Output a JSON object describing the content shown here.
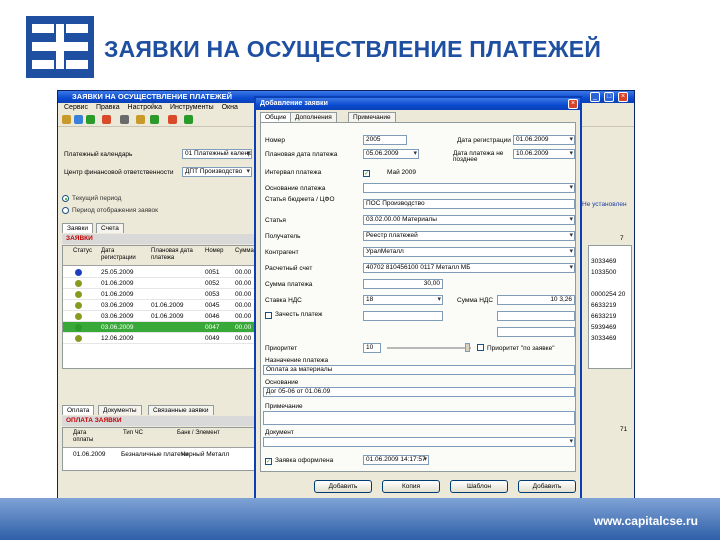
{
  "slide": {
    "title": "ЗАЯВКИ НА ОСУЩЕСТВЛЕНИЕ ПЛАТЕЖЕЙ",
    "url": "www.capitalcse.ru"
  },
  "app": {
    "title": "ЗАЯВКИ НА ОСУЩЕСТВЛЕНИЕ ПЛАТЕЖЕЙ",
    "menu": [
      "Сервис",
      "Правка",
      "Настройка",
      "Инструменты",
      "Окна"
    ],
    "calendar_label": "Платежный календарь",
    "calendar_value": "01 Платежный календарь",
    "center_label": "Центр финансовой ответственности",
    "center_value": "ДПТ Производство",
    "radio_current": "Текущий период",
    "radio_period": "Период отображения заявок",
    "right_note": "Не установлен",
    "tabs": [
      "Заявки",
      "Счета"
    ],
    "group_header": "ЗАЯВКИ",
    "grid_count": "7",
    "grid_columns": [
      "Статус",
      "Дата регистрации",
      "Плановая дата платежа",
      "Номер",
      "Сумма"
    ],
    "rows": [
      {
        "date": "25.05.2009",
        "plan": "",
        "num": "0051",
        "sum": "00.00",
        "status_color": "#1d3fbf"
      },
      {
        "date": "01.06.2009",
        "plan": "",
        "num": "0052",
        "sum": "00.00",
        "status_color": "#8a9a20"
      },
      {
        "date": "01.06.2009",
        "plan": "",
        "num": "0053",
        "sum": "00.00",
        "status_color": "#8a9a20"
      },
      {
        "date": "03.06.2009",
        "plan": "01.06.2009",
        "num": "0045",
        "sum": "00.00",
        "status_color": "#8a9a20"
      },
      {
        "date": "03.06.2009",
        "plan": "01.06.2009",
        "num": "0046",
        "sum": "00.00",
        "status_color": "#8a9a20"
      },
      {
        "date": "03.06.2009",
        "plan": "",
        "num": "0047",
        "sum": "00.00",
        "status_color": "#2a9a2a"
      },
      {
        "date": "12.06.2009",
        "plan": "",
        "num": "0049",
        "sum": "00.00",
        "status_color": "#8a9a20"
      }
    ],
    "right_codes": [
      "3033469",
      "1033500",
      "",
      "0000254 20",
      "6633219",
      "6633219",
      "5939469",
      "3033469"
    ],
    "bottom_tabs": [
      "Оплата",
      "Документы",
      "Связанные заявки"
    ],
    "bottom_group": "ОПЛАТА ЗАЯВКИ",
    "bottom_count": "71",
    "bottom_columns": [
      "Дата оплаты",
      "Тип ЧС",
      "Банк / Элемент"
    ],
    "bottom_row": {
      "date": "01.06.2009",
      "type": "Безналичные платежи",
      "bank": "Черный Металл"
    }
  },
  "dialog": {
    "title": "Добавление заявки",
    "tabs": [
      "Общие",
      "Дополнения",
      "Примечание"
    ],
    "fields": {
      "number_label": "Номер",
      "number_value": "2005",
      "reg_date_label": "Дата регистрации",
      "reg_date_value": "01.06.2009",
      "plan_date_label": "Плановая дата платежа",
      "plan_date_value": "05.06.2009",
      "pay_period_label": "Дата платежа не позднее",
      "pay_period_value": "10.06.2009",
      "interval_label": "Интервал платежа",
      "interval_value": "Май 2009",
      "contractor_label": "Основание платежа",
      "account_label": "Статья бюджета / ЦФО",
      "account_value": "ПОС Производство",
      "item_label": "Статья",
      "item_value": "03.02.00.00 Материалы",
      "recipient_label": "Получатель",
      "recipient_value": "Реестр платежей",
      "payee_label": "Контрагент",
      "payee_value": "УралМеталл",
      "settlement_label": "Расчетный счет",
      "settlement_value": "40702 810456100 0117 Металл МБ",
      "sum_label": "Сумма платежа",
      "sum_value": "30,00",
      "vat_label": "Ставка НДС",
      "vat_value": "18",
      "vat_sum_label": "Сумма НДС",
      "vat_sum_value": "10 3,26",
      "extra_label": "Зачесть платеж",
      "priority_label": "Приоритет",
      "priority_value": "10",
      "priority_note": "Приоритет \"по заявке\"",
      "purpose_label": "Назначение платежа",
      "purpose_value": "Оплата за материалы",
      "basis_label": "Основание",
      "basis_value": "Дог 05-06 от 01.06.09",
      "note_label": "Примечание",
      "document_label": "Документ",
      "closed_label": "Заявка оформлена",
      "closed_value": "01.06.2009 14:17:57"
    },
    "buttons": [
      "Добавить",
      "Копия",
      "Шаблон",
      "Добавить"
    ]
  }
}
